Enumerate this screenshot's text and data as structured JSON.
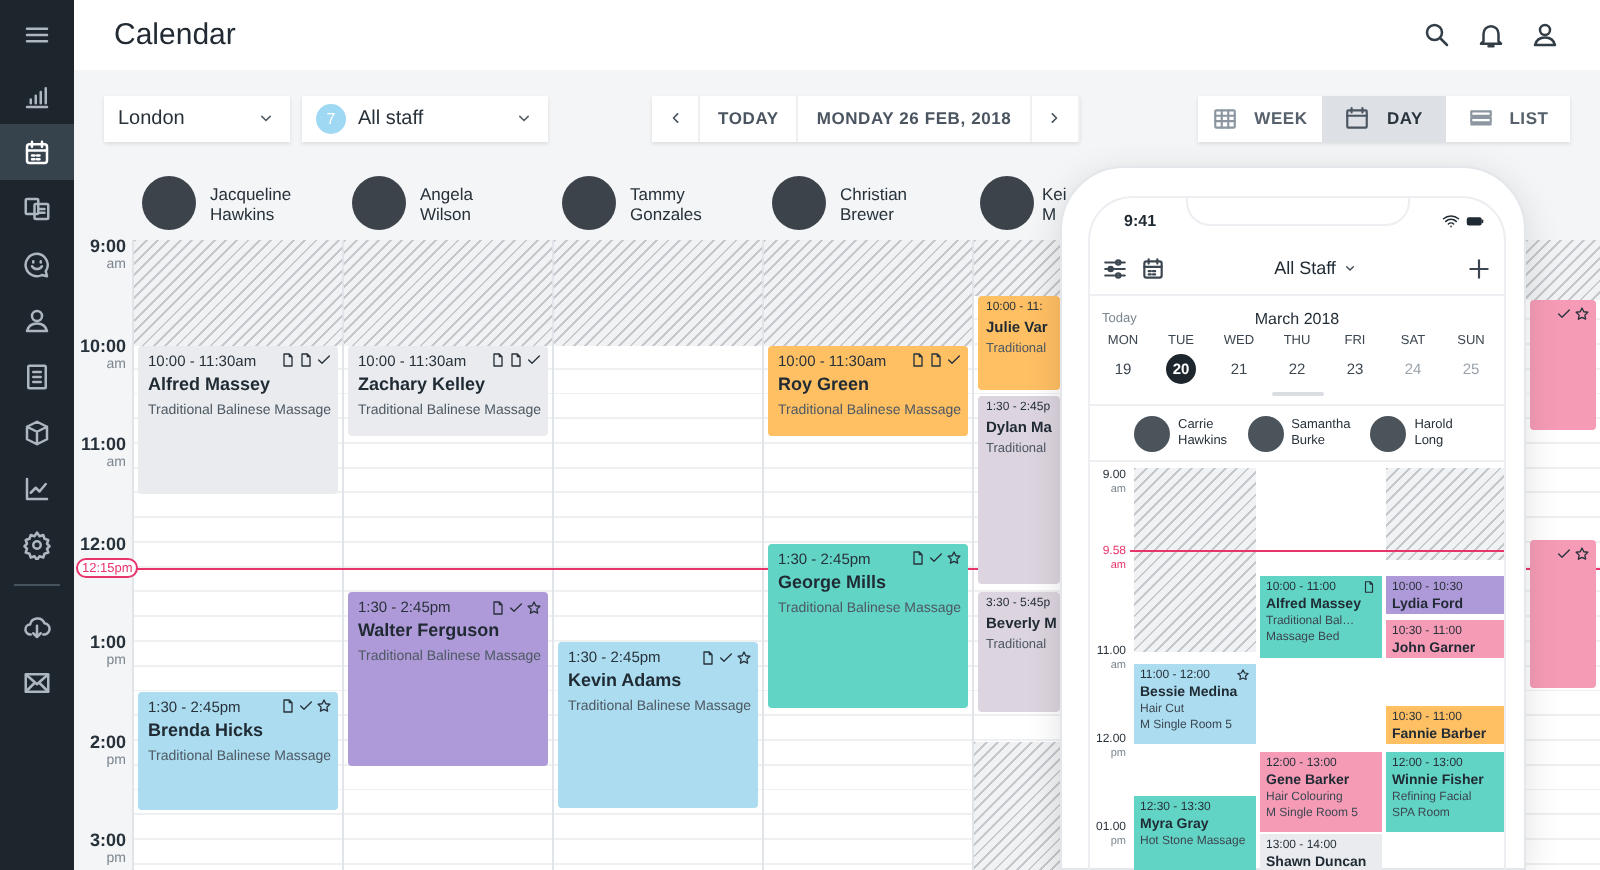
{
  "sidebar": {
    "items": [
      {
        "selected": false
      },
      {
        "selected": false
      },
      {
        "selected": true
      },
      {
        "selected": false
      },
      {
        "selected": false
      },
      {
        "selected": false
      },
      {
        "selected": false
      },
      {
        "selected": false
      },
      {
        "selected": false
      },
      {
        "selected": false
      },
      {
        "selected": false
      },
      {
        "selected": false
      }
    ]
  },
  "header": {
    "title": "Calendar"
  },
  "toolbar": {
    "location": "London",
    "staff_filter": {
      "count": "7",
      "value": "All staff"
    },
    "today": "TODAY",
    "date": "MONDAY 26 FEB, 2018",
    "views": [
      {
        "label": "WEEK",
        "selected": false
      },
      {
        "label": "DAY",
        "selected": true
      },
      {
        "label": "LIST",
        "selected": false
      }
    ]
  },
  "staff": [
    {
      "name": "Jacqueline Hawkins"
    },
    {
      "name": "Angela Wilson"
    },
    {
      "name": "Tammy Gonzales"
    },
    {
      "name": "Christian Brewer"
    },
    {
      "name": "Kei M"
    }
  ],
  "times": [
    {
      "hour": "9:00",
      "suffix": "am"
    },
    {
      "hour": "10:00",
      "suffix": "am"
    },
    {
      "hour": "11:00",
      "suffix": "am"
    },
    {
      "hour": "12:00"
    },
    {
      "hour": "1:00",
      "suffix": "pm"
    },
    {
      "hour": "2:00",
      "suffix": "pm"
    },
    {
      "hour": "3:00",
      "suffix": "pm"
    }
  ],
  "now": {
    "label": "12:15pm"
  },
  "columns": [
    {
      "events": [
        {
          "time": "10:00 - 11:30am",
          "client": "Alfred Massey",
          "service": "Traditional Balinese Massage",
          "color": "#e9ebef",
          "forms": true,
          "notes": true,
          "confirmed": true,
          "starred": false
        },
        {
          "time": "1:30 - 2:45pm",
          "client": "Brenda Hicks",
          "service": "Traditional Balinese Massage",
          "color": "#abdcf0",
          "forms": true,
          "notes": false,
          "confirmed": true,
          "starred": true
        }
      ]
    },
    {
      "events": [
        {
          "time": "10:00 - 11:30am",
          "client": "Zachary Kelley",
          "service": "Traditional Balinese Massage",
          "color": "#e9ebef",
          "forms": true,
          "notes": true,
          "confirmed": true,
          "starred": false
        },
        {
          "time": "1:30 - 2:45pm",
          "client": "Walter Ferguson",
          "service": "Traditional Balinese Massage",
          "color": "#af9ad9",
          "forms": true,
          "notes": false,
          "confirmed": true,
          "starred": true
        }
      ]
    },
    {
      "events": [
        {
          "time": "1:30 - 2:45pm",
          "client": "Kevin Adams",
          "service": "Traditional Balinese Massage",
          "color": "#abdcf0",
          "forms": true,
          "notes": false,
          "confirmed": true,
          "starred": true
        }
      ]
    },
    {
      "events": [
        {
          "time": "10:00 - 11:30am",
          "client": "Roy Green",
          "service": "Traditional Balinese Massage",
          "color": "#ffbf63",
          "forms": true,
          "notes": true,
          "confirmed": true,
          "starred": false
        },
        {
          "time": "1:30 - 2:45pm",
          "client": "George Mills",
          "service": "Traditional Balinese Massage",
          "color": "#62d4c5",
          "forms": true,
          "notes": false,
          "confirmed": true,
          "starred": true
        }
      ]
    },
    {
      "events": [
        {
          "time": "10:00 - 11:",
          "client": "Julie Var",
          "service": "Traditional",
          "color": "#ffbf63"
        },
        {
          "time": "1:30 - 2:45p",
          "client": "Dylan Ma",
          "service": "Traditional",
          "color": "#dcd4de"
        },
        {
          "time": "3:30 - 5:45p",
          "client": "Beverly M",
          "service": "Traditional",
          "color": "#dcd4de"
        }
      ]
    },
    {
      "events": [
        {
          "color": "#f59bb6",
          "confirmed": true,
          "starred": true
        },
        {
          "color": "#f59bb6",
          "confirmed": true,
          "starred": true
        }
      ]
    }
  ],
  "phone": {
    "clock": "9:41",
    "staff_filter": "All Staff",
    "today": "Today",
    "month": "March 2018",
    "days": [
      {
        "weekday": "MON",
        "date": "19",
        "selected": false,
        "weekend": false
      },
      {
        "weekday": "TUE",
        "date": "20",
        "selected": true,
        "weekend": false
      },
      {
        "weekday": "WED",
        "date": "21",
        "selected": false,
        "weekend": false
      },
      {
        "weekday": "THU",
        "date": "22",
        "selected": false,
        "weekend": false
      },
      {
        "weekday": "FRI",
        "date": "23",
        "selected": false,
        "weekend": false
      },
      {
        "weekday": "SAT",
        "date": "24",
        "selected": false,
        "weekend": true
      },
      {
        "weekday": "SUN",
        "date": "25",
        "selected": false,
        "weekend": true
      }
    ],
    "staff": [
      {
        "name": "Carrie Hawkins"
      },
      {
        "name": "Samantha Burke"
      },
      {
        "name": "Harold Long"
      }
    ],
    "times": [
      {
        "hour": "9.00",
        "suffix": "am"
      },
      {
        "hour": "11.00",
        "suffix": "am"
      },
      {
        "hour": "12.00",
        "suffix": "pm"
      },
      {
        "hour": "01.00",
        "suffix": "pm"
      }
    ],
    "now": {
      "hour": "9.58",
      "suffix": "am"
    },
    "columns": [
      {
        "events": [
          {
            "time": "11:00 - 12:00",
            "client": "Bessie Medina",
            "details": [
              "Hair Cut",
              "M Single Room 5"
            ],
            "color": "#abdcf0",
            "starred": true
          },
          {
            "time": "12:30 - 13:30",
            "client": "Myra Gray",
            "details": [
              "Hot Stone Massage"
            ],
            "color": "#62d4c5"
          }
        ]
      },
      {
        "events": [
          {
            "time": "10:00 - 11:00",
            "client": "Alfred Massey",
            "details": [
              "Traditional Bal…",
              "Massage Bed"
            ],
            "color": "#62d4c5",
            "forms": true
          },
          {
            "time": "12:00 - 13:00",
            "client": "Gene Barker",
            "details": [
              "Hair Colouring",
              "M Single Room 5"
            ],
            "color": "#f59bb6"
          },
          {
            "time": "13:00 - 14:00",
            "client": "Shawn Duncan",
            "color": "#e9ebef"
          }
        ]
      },
      {
        "events": [
          {
            "time": "10:00 - 10:30",
            "client": "Lydia Ford",
            "color": "#af9ad9"
          },
          {
            "time": "10:30 - 11:00",
            "client": "John Garner",
            "color": "#f59bb6"
          },
          {
            "time": "10:30 - 11:00",
            "client": "Fannie Barber",
            "color": "#ffbf63"
          },
          {
            "time": "12:00 - 13:00",
            "client": "Winnie Fisher",
            "details": [
              "Refining Facial",
              "SPA Room"
            ],
            "color": "#62d4c5"
          }
        ]
      }
    ]
  }
}
